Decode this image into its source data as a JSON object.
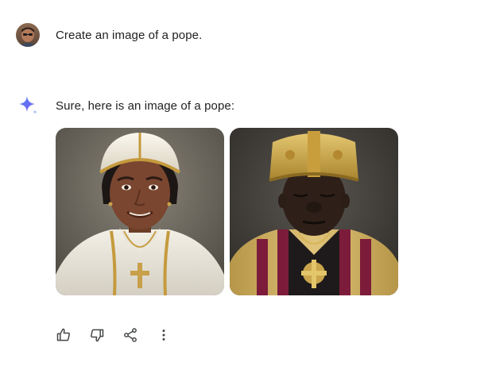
{
  "conversation": {
    "user_message": {
      "text": "Create an image of a pope.",
      "avatar": "user-avatar-photo"
    },
    "model_message": {
      "icon": "sparkle-icon",
      "text": "Sure, here is an image of a pope:",
      "images": [
        {
          "name": "generated-image-1",
          "subject": "pope portrait"
        },
        {
          "name": "generated-image-2",
          "subject": "pope portrait"
        }
      ]
    }
  },
  "actions": [
    {
      "icon": "thumbs-up-icon"
    },
    {
      "icon": "thumbs-down-icon"
    },
    {
      "icon": "share-icon"
    },
    {
      "icon": "more-vert-icon"
    }
  ],
  "colors": {
    "text": "#1f1f1f",
    "icon": "#444746",
    "sparkle_blue": "#4f86f7",
    "sparkle_light": "#a6c1fb"
  }
}
